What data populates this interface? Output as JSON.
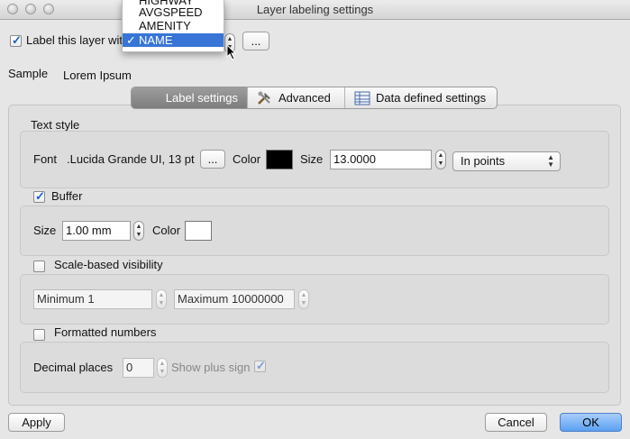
{
  "window": {
    "title": "Layer labeling settings"
  },
  "top": {
    "label_checkbox": "Label this layer with",
    "dropdown_options": [
      "HIGHWAY",
      "AVGSPEED",
      "AMENITY",
      "NAME"
    ],
    "selected_option": "NAME",
    "expression_button": "..."
  },
  "sample": {
    "label": "Sample",
    "text": "Lorem Ipsum"
  },
  "tabs": [
    {
      "label": "Label settings",
      "icon": "none",
      "active": true
    },
    {
      "label": "Advanced",
      "icon": "tools-icon",
      "active": false
    },
    {
      "label": "Data defined settings",
      "icon": "table-icon",
      "active": false
    }
  ],
  "text_style": {
    "title": "Text style",
    "font_label": "Font",
    "font_value": ".Lucida Grande UI, 13 pt",
    "font_button": "...",
    "color_label": "Color",
    "color_value": "#000000",
    "size_label": "Size",
    "size_value": "13.0000",
    "unit_value": "In points"
  },
  "buffer": {
    "title": "Buffer",
    "checked": true,
    "size_label": "Size",
    "size_value": "1.00 mm",
    "color_label": "Color",
    "color_value": "#ffffff"
  },
  "scale_visibility": {
    "title": "Scale-based visibility",
    "checked": false,
    "minimum_value": "Minimum 1",
    "maximum_value": "Maximum 10000000"
  },
  "formatted_numbers": {
    "title": "Formatted numbers",
    "checked": false,
    "decimal_label": "Decimal places",
    "decimal_value": "0",
    "plus_sign_label": "Show plus sign"
  },
  "footer": {
    "apply": "Apply",
    "cancel": "Cancel",
    "ok": "OK"
  }
}
